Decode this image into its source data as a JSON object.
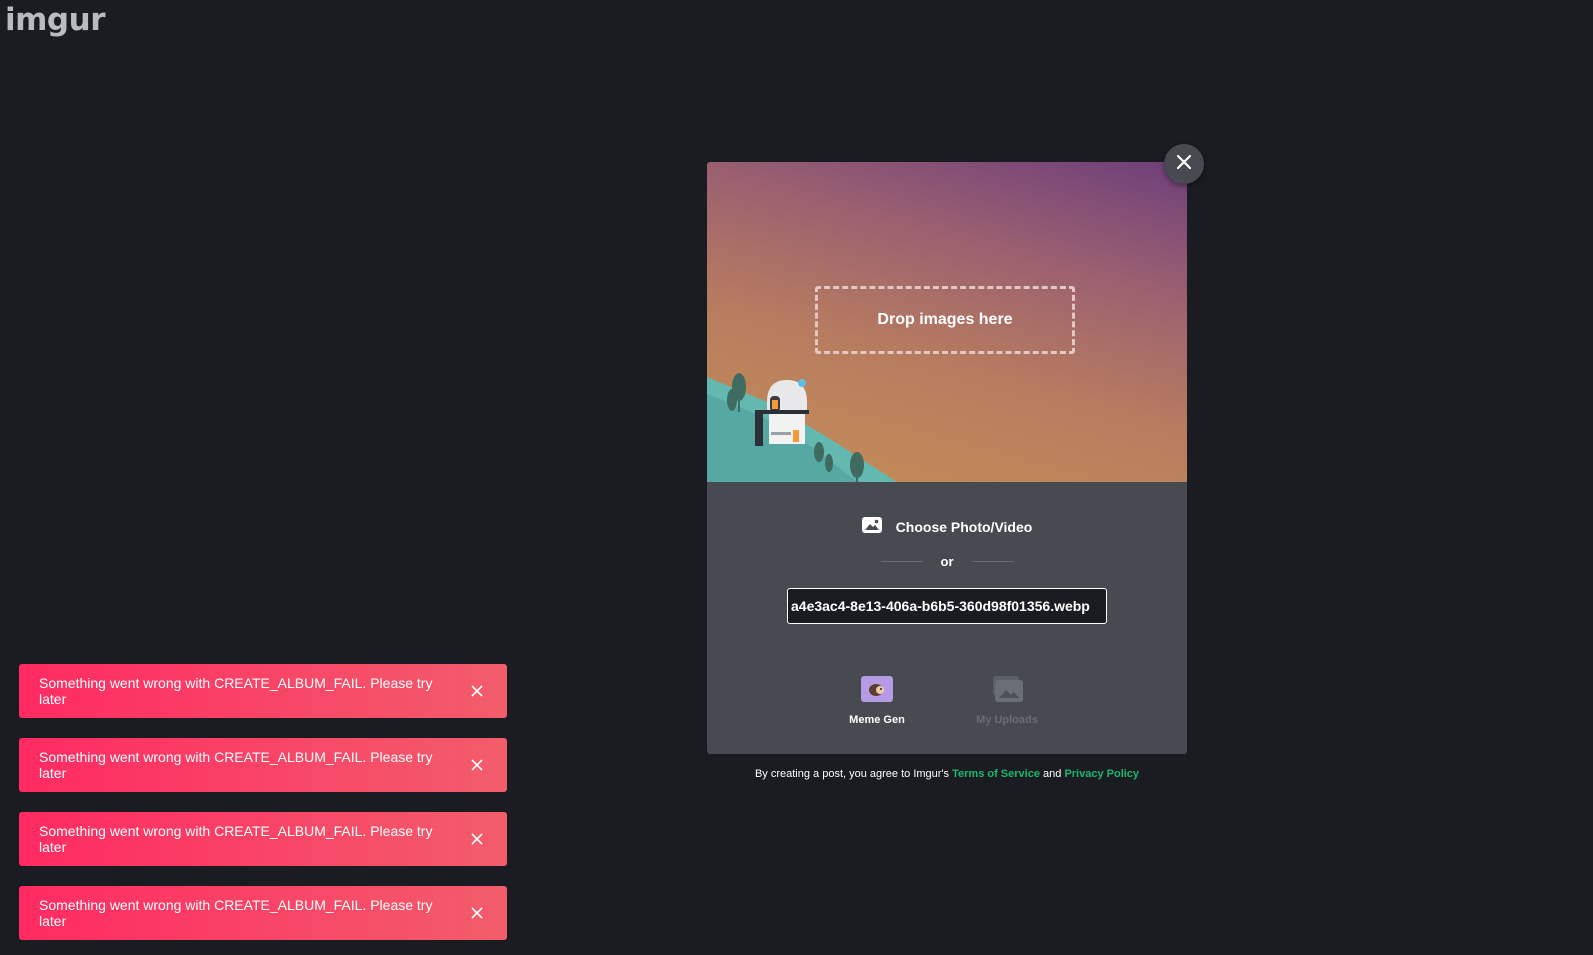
{
  "header": {
    "logo_text": "imgur"
  },
  "upload_modal": {
    "drop_label": "Drop images here",
    "choose_label": "Choose Photo/Video",
    "or_label": "or",
    "url_value": "a4e3ac4-8e13-406a-b6b5-360d98f01356.webp",
    "tools": [
      {
        "label": "Meme Gen",
        "icon": "meme-gen-icon"
      },
      {
        "label": "My Uploads",
        "icon": "my-uploads-icon"
      }
    ]
  },
  "terms": {
    "prefix": "By creating a post, you agree to Imgur's",
    "tos_link": "Terms of Service",
    "and": "and",
    "privacy_link": "Privacy Policy"
  },
  "toasts": [
    {
      "message": "Something went wrong with CREATE_ALBUM_FAIL. Please try later"
    },
    {
      "message": "Something went wrong with CREATE_ALBUM_FAIL. Please try later"
    },
    {
      "message": "Something went wrong with CREATE_ALBUM_FAIL. Please try later"
    },
    {
      "message": "Something went wrong with CREATE_ALBUM_FAIL. Please try later"
    }
  ],
  "colors": {
    "background": "#1b1c22",
    "modal": "#474a51",
    "accent_green": "#1bb76e",
    "toast_start": "#ff2a62",
    "toast_end": "#f25d6b"
  }
}
